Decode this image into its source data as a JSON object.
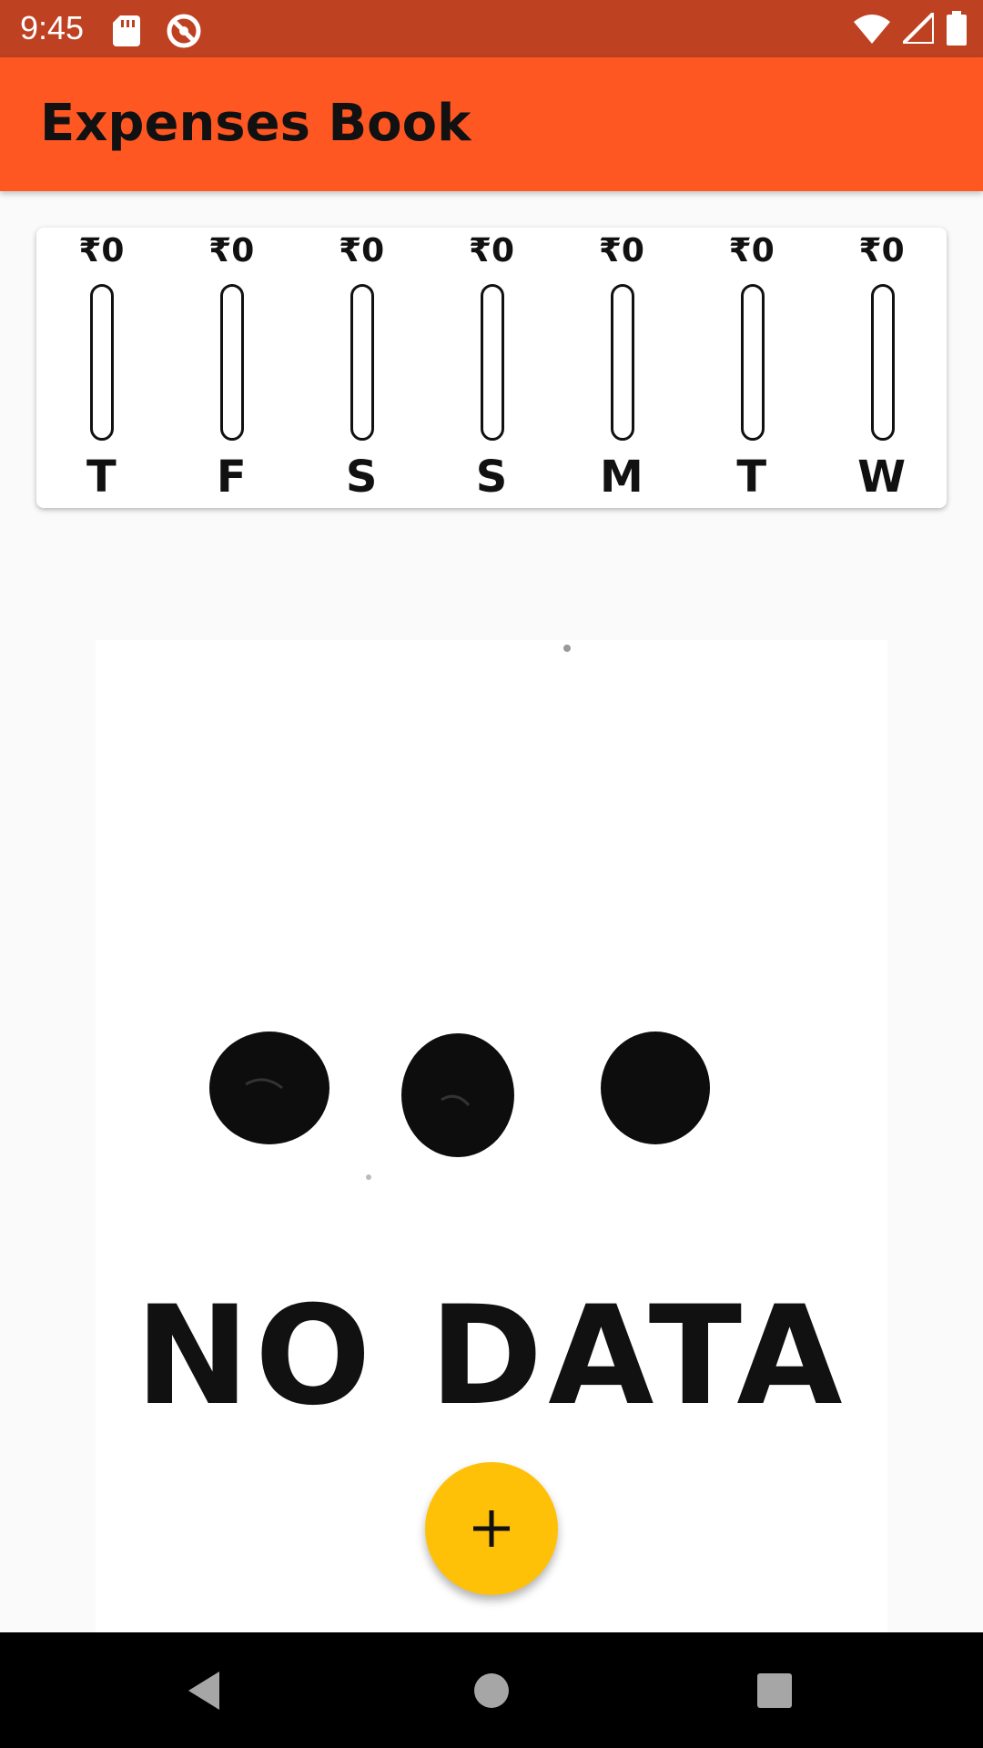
{
  "status_bar": {
    "time": "9:45",
    "left_icons": [
      "sd-card-icon",
      "do-not-disturb-icon"
    ],
    "right_icons": [
      "wifi-icon",
      "cell-signal-icon",
      "battery-icon"
    ]
  },
  "app_bar": {
    "title": "Expenses Book",
    "color": "#ff5722"
  },
  "chart_data": {
    "type": "bar",
    "categories": [
      "T",
      "F",
      "S",
      "S",
      "M",
      "T",
      "W"
    ],
    "values": [
      0,
      0,
      0,
      0,
      0,
      0,
      0
    ],
    "amount_labels": [
      "₹0",
      "₹0",
      "₹0",
      "₹0",
      "₹0",
      "₹0",
      "₹0"
    ],
    "fill_color": "#ff5722"
  },
  "empty_state": {
    "image_text": "NO DATA"
  },
  "fab": {
    "icon": "plus-icon",
    "color": "#ffc107"
  },
  "nav_bar": {
    "buttons": [
      "back-icon",
      "home-icon",
      "recents-icon"
    ]
  }
}
